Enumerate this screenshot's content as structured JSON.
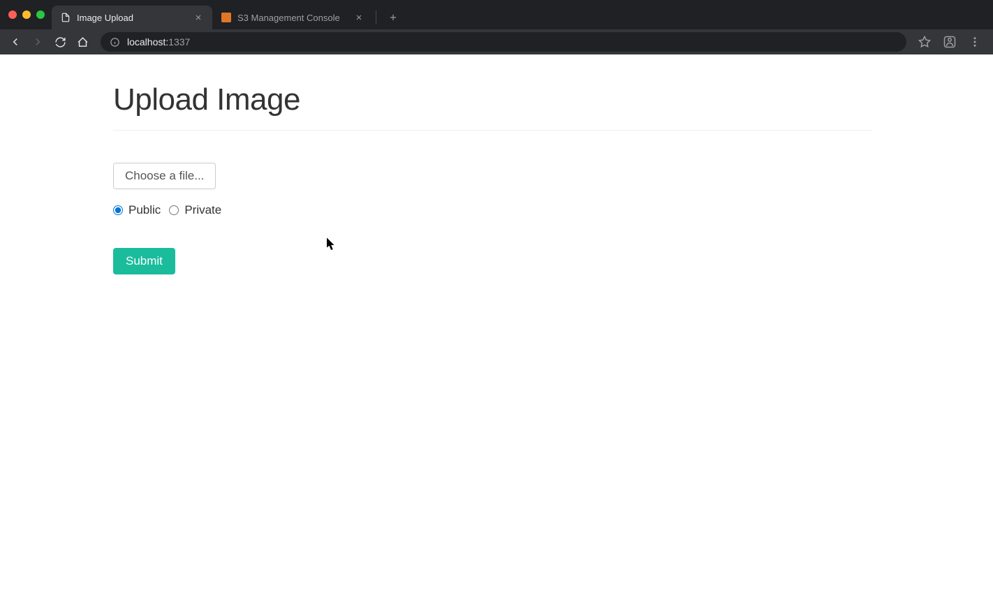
{
  "browser": {
    "tabs": [
      {
        "title": "Image Upload",
        "active": true,
        "favicon": "file-icon"
      },
      {
        "title": "S3 Management Console",
        "active": false,
        "favicon": "aws-s3-icon"
      }
    ],
    "url_host": "localhost:",
    "url_port": "1337"
  },
  "page": {
    "heading": "Upload Image",
    "file_button_label": "Choose a file...",
    "radio_public_label": "Public",
    "radio_private_label": "Private",
    "radio_selected": "public",
    "submit_label": "Submit"
  }
}
